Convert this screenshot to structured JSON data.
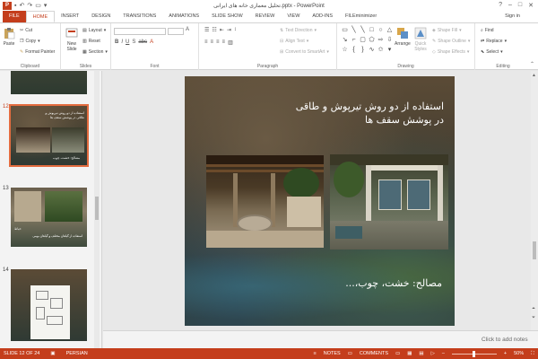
{
  "window": {
    "title": "تحلیل معماری خانه های ایرانی.pptx - PowerPoint",
    "app_badge": "P",
    "controls": [
      "?",
      "–",
      "□",
      "✕"
    ]
  },
  "ribbon_tabs": [
    {
      "label": "FILE"
    },
    {
      "label": "HOME"
    },
    {
      "label": "INSERT"
    },
    {
      "label": "DESIGN"
    },
    {
      "label": "TRANSITIONS"
    },
    {
      "label": "ANIMATIONS"
    },
    {
      "label": "SLIDE SHOW"
    },
    {
      "label": "REVIEW"
    },
    {
      "label": "VIEW"
    },
    {
      "label": "ADD-INS"
    },
    {
      "label": "FILEminimizer"
    }
  ],
  "sign_in": "Sign in",
  "ribbon": {
    "clipboard": {
      "paste": "Paste",
      "cut": "Cut",
      "copy": "Copy",
      "format_painter": "Format Painter",
      "label": "Clipboard"
    },
    "slides": {
      "new_slide": "New Slide",
      "layout": "Layout",
      "reset": "Reset",
      "section": "Section",
      "label": "Slides"
    },
    "font": {
      "label": "Font"
    },
    "paragraph": {
      "text_direction": "Text Direction",
      "align_text": "Align Text",
      "convert_smartart": "Convert to SmartArt",
      "label": "Paragraph"
    },
    "drawing": {
      "arrange": "Arrange",
      "quick_styles": "Quick Styles",
      "shape_fill": "Shape Fill",
      "shape_outline": "Shape Outline",
      "shape_effects": "Shape Effects",
      "label": "Drawing"
    },
    "editing": {
      "find": "Find",
      "replace": "Replace",
      "select": "Select",
      "label": "Editing"
    }
  },
  "thumbnails": [
    {
      "number": "12",
      "caption_top": "استفاده از دو روش تیرپوش و طاقی در پوشش سقف ها",
      "caption_bottom": "مصالح: خشت، چوب",
      "selected": true
    },
    {
      "number": "13",
      "caption_top": "حیاط",
      "caption_bottom": "استفاده از گیاهان مختلف و گیاهان بومی",
      "selected": false
    },
    {
      "number": "14",
      "caption_top": "",
      "caption_bottom": "",
      "selected": false
    }
  ],
  "slide": {
    "heading": "استفاده از دو روش تیرپوش و طاقی در پوشش سقف ها",
    "materials": "مصالح: خشت، چوب،..."
  },
  "notes_placeholder": "Click to add notes",
  "status": {
    "slide_info": "SLIDE 12 OF 24",
    "language": "PERSIAN",
    "notes": "NOTES",
    "comments": "COMMENTS",
    "zoom": "50%",
    "zoom_fraction": 0.5
  }
}
